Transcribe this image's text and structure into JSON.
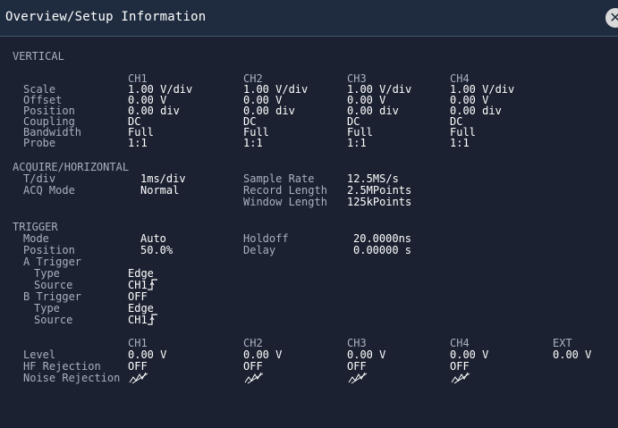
{
  "window": {
    "title": "Overview/Setup Information",
    "close_icon": "close-icon"
  },
  "vertical": {
    "section_label": "VERTICAL",
    "channels": [
      "CH1",
      "CH2",
      "CH3",
      "CH4"
    ],
    "rows": [
      {
        "label": "Scale",
        "values": [
          "1.00 V/div",
          "1.00 V/div",
          "1.00 V/div",
          "1.00 V/div"
        ]
      },
      {
        "label": "Offset",
        "values": [
          "0.00 V",
          "0.00 V",
          "0.00 V",
          "0.00 V"
        ]
      },
      {
        "label": "Position",
        "values": [
          "0.00 div",
          "0.00 div",
          "0.00 div",
          "0.00 div"
        ]
      },
      {
        "label": "Coupling",
        "values": [
          "DC",
          "DC",
          "DC",
          "DC"
        ]
      },
      {
        "label": "Bandwidth",
        "values": [
          "Full",
          "Full",
          "Full",
          "Full"
        ]
      },
      {
        "label": "Probe",
        "values": [
          "1:1",
          "1:1",
          "1:1",
          "1:1"
        ]
      }
    ]
  },
  "acquire": {
    "section_label": "ACQUIRE/HORIZONTAL",
    "tdiv_label": "T/div",
    "tdiv_value": "1ms/div",
    "acq_mode_label": "ACQ Mode",
    "acq_mode_value": "Normal",
    "sample_rate_label": "Sample Rate",
    "sample_rate_value": "12.5MS/s",
    "record_length_label": "Record Length",
    "record_length_value": "2.5MPoints",
    "window_length_label": "Window Length",
    "window_length_value": "125kPoints"
  },
  "trigger": {
    "section_label": "TRIGGER",
    "mode_label": "Mode",
    "mode_value": "Auto",
    "holdoff_label": "Holdoff",
    "holdoff_value": "20.0000ns",
    "position_label": "Position",
    "position_value": "50.0%",
    "delay_label": "Delay",
    "delay_value": "0.00000 s",
    "a_trigger_label": "A Trigger",
    "a_type_label": "Type",
    "a_type_value": "Edge",
    "a_source_label": "Source",
    "a_source_value": "CH1",
    "a_source_slope_icon": "rising-edge-icon",
    "b_trigger_label": "B Trigger",
    "b_trigger_value": "OFF",
    "b_type_label": "Type",
    "b_type_value": "Edge",
    "b_source_label": "Source",
    "b_source_value": "CH1",
    "b_source_slope_icon": "rising-edge-icon",
    "channels": [
      "CH1",
      "CH2",
      "CH3",
      "CH4",
      "EXT"
    ],
    "level_label": "Level",
    "level_values": [
      "0.00 V",
      "0.00 V",
      "0.00 V",
      "0.00 V",
      "0.00 V"
    ],
    "hf_rejection_label": "HF Rejection",
    "hf_rejection_values": [
      "OFF",
      "OFF",
      "OFF",
      "OFF"
    ],
    "noise_rejection_label": "Noise Rejection",
    "noise_rejection_icon": "noise-rejection-off-icon"
  }
}
